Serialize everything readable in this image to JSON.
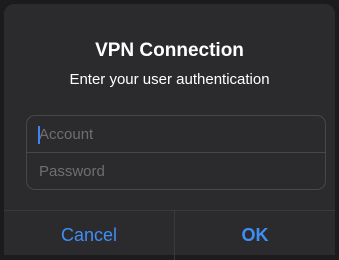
{
  "dialog": {
    "title": "VPN Connection",
    "message": "Enter your user authentication"
  },
  "fields": {
    "account": {
      "value": "",
      "placeholder": "Account",
      "focused": true
    },
    "password": {
      "value": "",
      "placeholder": "Password"
    }
  },
  "buttons": {
    "cancel_label": "Cancel",
    "ok_label": "OK"
  },
  "colors": {
    "background": "#2b2b2d",
    "text": "#ffffff",
    "placeholder": "#6e6e73",
    "accent": "#3f8ef5",
    "caret": "#3d84f7",
    "separator": "#3a3a3c"
  }
}
